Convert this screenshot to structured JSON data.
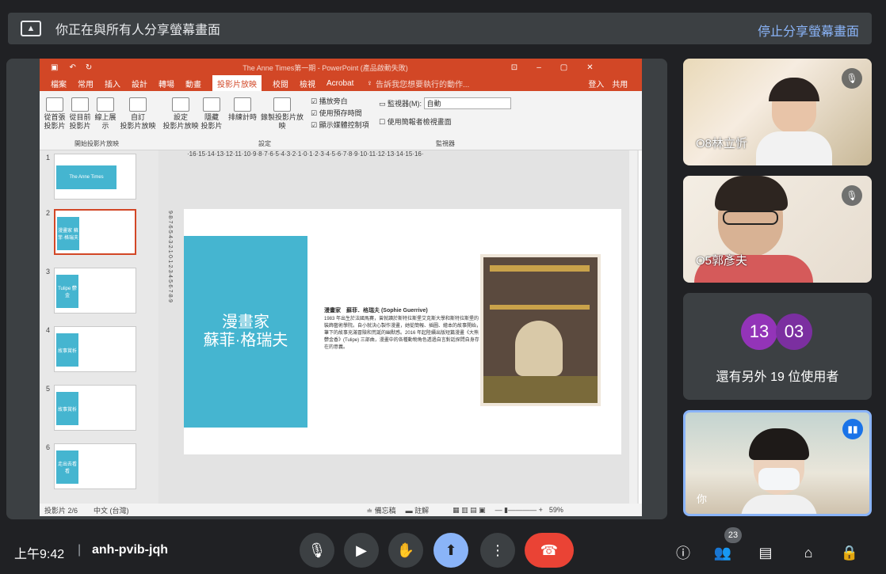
{
  "topbar": {
    "share_icon": "present-icon",
    "title": "你正在與所有人分享螢幕畫面",
    "stop_share": "停止分享螢幕畫面"
  },
  "powerpoint": {
    "window_title": "The Anne Times第一期 - PowerPoint (產品啟動失敗)",
    "tabs": [
      "檔案",
      "常用",
      "插入",
      "設計",
      "轉場",
      "動畫",
      "投影片放映",
      "校閱",
      "檢視",
      "Acrobat"
    ],
    "active_tab": "投影片放映",
    "search_hint": "告訴我您想要執行的動作...",
    "login": "登入",
    "share": "共用",
    "ribbon": {
      "btn_from_start": "從首張\n投影片",
      "btn_from_current": "從目前\n投影片",
      "btn_online": "線上展\n示",
      "btn_custom": "自訂\n投影片放映",
      "btn_setup": "設定\n投影片放映",
      "btn_hide": "隱藏\n投影片",
      "btn_rehearse": "排練計時",
      "btn_record": "錄製投影片放映",
      "chk_narration": "播放旁白",
      "chk_timings": "使用預存時間",
      "chk_controls": "顯示媒體控制項",
      "monitor_label": "監視器(M):",
      "monitor_value": "自動",
      "presenter_view": "使用簡報者檢視畫面",
      "group_start": "開始投影片放映",
      "group_setup": "設定",
      "group_monitor": "監視器"
    },
    "ruler_text": "·16·15·14·13·12·11·10·9·8·7·6·5·4·3·2·1·0·1·2·3·4·5·6·7·8·9·10·11·12·13·14·15·16·",
    "vruler_text": "9·8·7·6·5·4·3·2·1·0·1·2·3·4·5·6·7·8·9",
    "thumbnails": [
      {
        "num": "1",
        "text": "The Anne Times"
      },
      {
        "num": "2",
        "text": "漫畫家 蘇菲·格瑞夫"
      },
      {
        "num": "3",
        "text": "Tulipe 鬱金"
      },
      {
        "num": "4",
        "text": "故事賞析"
      },
      {
        "num": "5",
        "text": "故事賞析"
      },
      {
        "num": "6",
        "text": "走出去看看"
      }
    ],
    "slide": {
      "title_line1": "漫畫家",
      "title_line2": "蘇菲·格瑞夫",
      "body_heading": "漫畫家　蘇菲．格瑞夫 (Sophie Guerrive)",
      "body_text": "1983 年出生於法國馬賽，曾就讀於斯特拉斯堡艾克斯大學和斯特拉斯堡的裝飾藝術學院。自小就決心製作漫畫，她從簡報、插圖、繪本的故事開始，筆下的故事充滿冒險和荒誕的幽默感。2016 年起陸續出版短篇漫畫《大熊鬱金香》(Tulipe) 三部曲，漫畫中的各種動物角色透過自言對話探問自身存在的意義。"
    },
    "status": {
      "slide_pos": "投影片 2/6",
      "lang": "中文 (台灣)",
      "notes": "備忘稿",
      "comments": "註解",
      "zoom": "59%"
    }
  },
  "participants": [
    {
      "name": "O8林立忻",
      "muted": true
    },
    {
      "name": "O5郭彥夫",
      "muted": true
    }
  ],
  "others": {
    "avatar1": "13",
    "avatar2": "03",
    "label": "還有另外 19 位使用者",
    "color1": "#9334b8",
    "color2": "#7b2fa0"
  },
  "self_tile": {
    "label": "你"
  },
  "bottom": {
    "time": "上午9:42",
    "meeting_code": "anh-pvib-jqh",
    "people_count": "23"
  },
  "colors": {
    "pp_orange": "#d24726",
    "slide_blue": "#45b5d0",
    "hangup": "#ea4335",
    "present_active": "#8ab4f8"
  }
}
